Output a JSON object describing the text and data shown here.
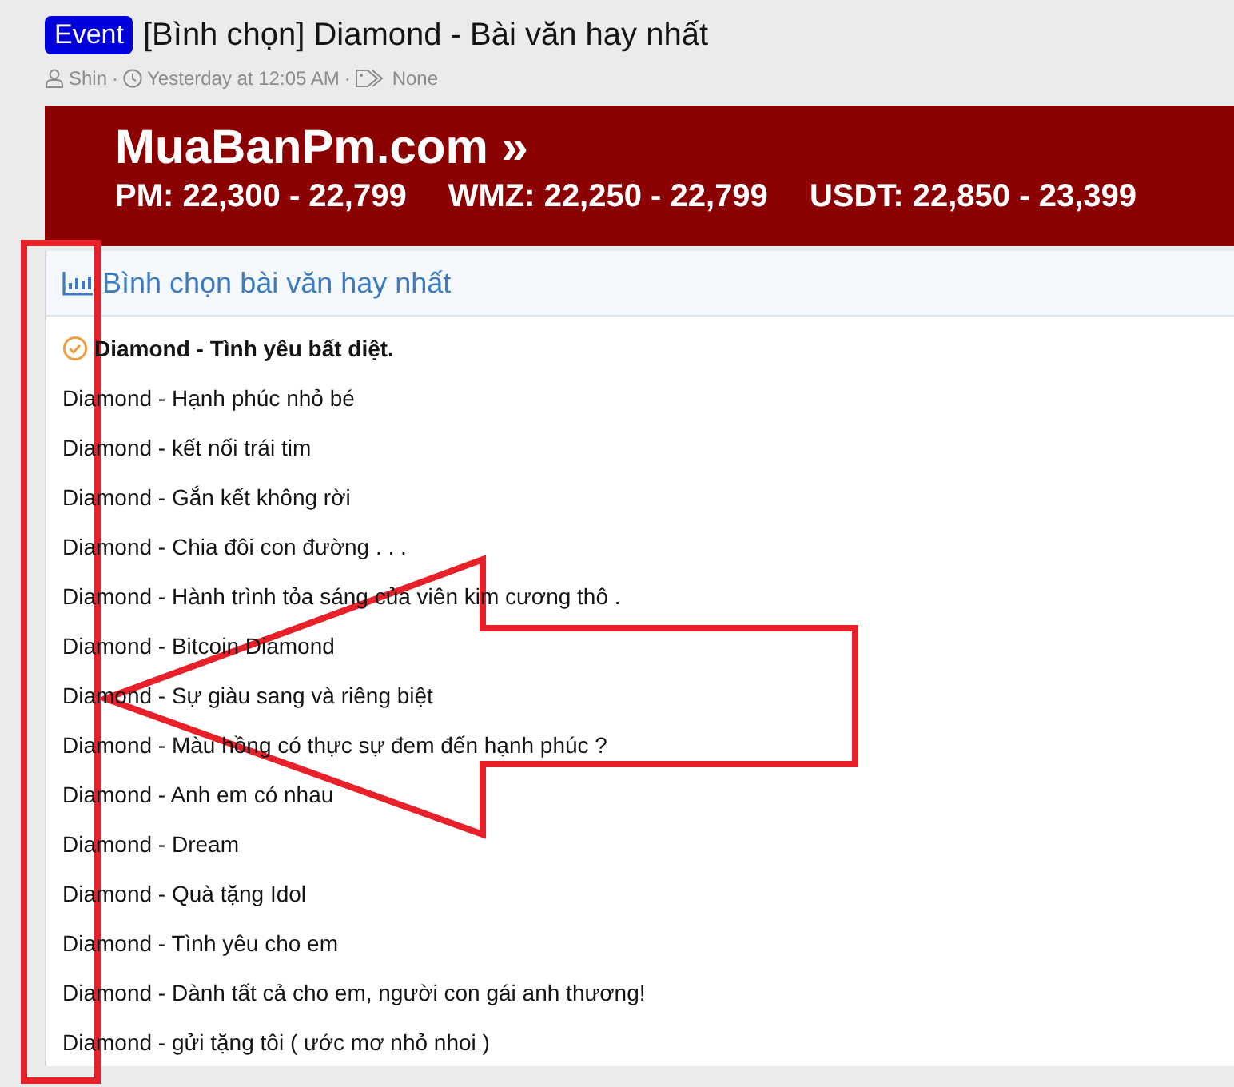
{
  "thread": {
    "badge": "Event",
    "title": "[Bình chọn] Diamond - Bài văn hay nhất",
    "author": "Shin",
    "time": "Yesterday at 12:05 AM",
    "tags": "None",
    "separators": [
      "·",
      "·"
    ]
  },
  "banner": {
    "site": "MuaBanPm.com »",
    "rates": [
      "PM: 22,300 - 22,799",
      "WMZ: 22,250 - 22,799",
      "USDT: 22,850 - 23,399"
    ]
  },
  "poll": {
    "title": "Bình chọn bài văn hay nhất",
    "options": [
      {
        "label": "Diamond - Tình yêu bất diệt.",
        "selected": true
      },
      {
        "label": "Diamond - Hạnh phúc nhỏ bé",
        "selected": false
      },
      {
        "label": "Diamond - kết nối trái tim",
        "selected": false
      },
      {
        "label": "Diamond - Gắn kết không rời",
        "selected": false
      },
      {
        "label": "Diamond - Chia đôi con đường . . .",
        "selected": false
      },
      {
        "label": "Diamond - Hành trình tỏa sáng của viên kim cương thô .",
        "selected": false
      },
      {
        "label": "Diamond - Bitcoin Diamond",
        "selected": false
      },
      {
        "label": "Diamond - Sự giàu sang và riêng biệt",
        "selected": false
      },
      {
        "label": "Diamond - Màu hồng có thực sự đem đến hạnh phúc ?",
        "selected": false
      },
      {
        "label": "Diamond - Anh em có nhau",
        "selected": false
      },
      {
        "label": "Diamond - Dream",
        "selected": false
      },
      {
        "label": "Diamond - Quà tặng Idol",
        "selected": false
      },
      {
        "label": "Diamond - Tình yêu cho em",
        "selected": false
      },
      {
        "label": "Diamond - Dành tất cả cho em, người con gái anh thương!",
        "selected": false
      },
      {
        "label": "Diamond - gửi tặng tôi ( ước mơ nhỏ nhoi )",
        "selected": false
      }
    ]
  }
}
